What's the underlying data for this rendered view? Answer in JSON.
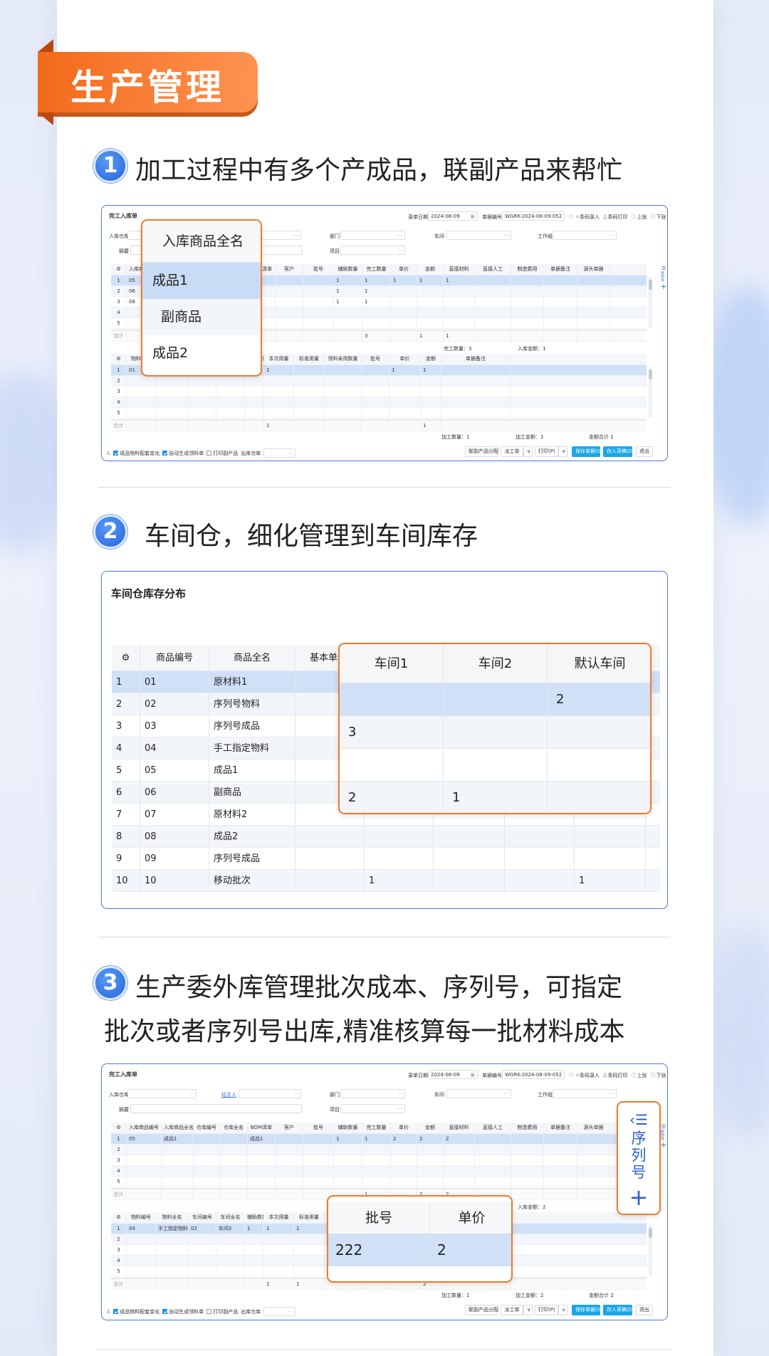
{
  "header": {
    "title": "生产管理"
  },
  "sections": [
    {
      "number": "1",
      "title": "加工过程中有多个产成品，联副产品来帮忙"
    },
    {
      "number": "2",
      "title": "车间仓，细化管理到车间库存"
    },
    {
      "number": "3",
      "title_lines": [
        "生产委外库管理批次成本、序列号，可指定",
        "批次或者序列号出库,精准核算每一批材料成本"
      ]
    }
  ],
  "colors": {
    "accent_orange": "#f07a2a",
    "brand_blue": "#2466dd",
    "selected_row": "#cfe0f7",
    "primary_button": "#1aa6ea"
  },
  "screen1": {
    "title": "完工入库单",
    "date_label": "录单日期",
    "date": "2024-08-09",
    "no_label": "单据编号",
    "no": "WGRK-2024-08-09-052",
    "toolbar": [
      "条码录入",
      "条码打印",
      "上张",
      "下张",
      "更多"
    ],
    "fields_row1": [
      {
        "label": "入库仓库"
      },
      {
        "label": ""
      },
      {
        "label": "部门"
      },
      {
        "label": "车间"
      },
      {
        "label": "工作组"
      }
    ],
    "fields_row2": [
      {
        "label": "摘要"
      },
      {
        "label": "项目"
      }
    ],
    "grid1": {
      "headers": [
        "入库商品编号",
        "入库商品全名",
        "仓库编号",
        "仓库全名",
        "BOM清单",
        "客户",
        "批号",
        "辅助数量",
        "完工数量",
        "单价",
        "金额",
        "直接材料",
        "直接人工",
        "制造费用",
        "单据备注",
        "源头单据"
      ],
      "rows": [
        [
          "05",
          "",
          "",
          "",
          "",
          "",
          "",
          "1",
          "1",
          "1",
          "1",
          "1",
          "",
          "",
          "",
          ""
        ],
        [
          "06",
          "",
          "",
          "",
          "",
          "",
          "",
          "1",
          "1",
          "",
          "",
          "",
          "",
          "",
          "",
          ""
        ],
        [
          "08",
          "",
          "",
          "",
          "",
          "",
          "",
          "1",
          "1",
          "",
          "",
          "",
          "",
          "",
          "",
          ""
        ]
      ],
      "total_label": "合计",
      "totals": [
        "",
        "",
        "",
        "",
        "",
        "",
        "",
        "",
        "3",
        "",
        "1",
        "1",
        "",
        "",
        "",
        ""
      ]
    },
    "summary1": [
      "完工数量：3",
      "入库金额：1"
    ],
    "grid2": {
      "headers": [
        "物料编号",
        "物料全名",
        "车间编号",
        "车间全名",
        "辅助数量",
        "本次用量",
        "标准用量",
        "领料未用数量",
        "批号",
        "单价",
        "金额",
        "单据备注"
      ],
      "rows": [
        [
          "01",
          "",
          "",
          "",
          "",
          "1",
          "",
          "",
          "",
          "1",
          "1",
          ""
        ]
      ],
      "total_label": "合计",
      "totals": [
        "",
        "",
        "",
        "",
        "",
        "1",
        "",
        "",
        "",
        "",
        "1",
        ""
      ]
    },
    "summary2": [
      "加工数量：1",
      "加工金额：1",
      "金额合计 1"
    ],
    "footer": {
      "checks": [
        {
          "label": "成品物料配套变化",
          "checked": true
        },
        {
          "label": "自动生成领料单",
          "checked": true
        },
        {
          "label": "打印副产品",
          "checked": false
        }
      ],
      "out_wh_label": "出库仓库",
      "buttons": [
        "联副产品分配",
        "派工单",
        "∨",
        "打印(P)",
        "∨",
        "保存单据(S)",
        "存入草稿(D)",
        "退出"
      ]
    },
    "side": {
      "label": "序列号",
      "add": "+"
    },
    "popup": {
      "header": "入库商品全名",
      "items": [
        "成品1",
        "副商品",
        "成品2"
      ],
      "selected": 0
    }
  },
  "screen2": {
    "title": "车间仓库存分布",
    "headers": [
      "商品编号",
      "商品全名",
      "基本单位",
      "",
      "",
      "",
      ""
    ],
    "rows": [
      [
        "1",
        "01",
        "原材料1",
        "",
        "",
        "",
        "",
        ""
      ],
      [
        "2",
        "02",
        "序列号物料",
        "",
        "",
        "",
        "",
        ""
      ],
      [
        "3",
        "03",
        "序列号成品",
        "",
        "",
        "",
        "",
        ""
      ],
      [
        "4",
        "04",
        "手工指定物料",
        "",
        "",
        "",
        "",
        ""
      ],
      [
        "5",
        "05",
        "成品1",
        "",
        "",
        "",
        "",
        ""
      ],
      [
        "6",
        "06",
        "副商品",
        "",
        "",
        "",
        "",
        ""
      ],
      [
        "7",
        "07",
        "原材料2",
        "",
        "",
        "",
        "",
        ""
      ],
      [
        "8",
        "08",
        "成品2",
        "",
        "",
        "",
        "",
        ""
      ],
      [
        "9",
        "09",
        "序列号成品",
        "",
        "",
        "",
        "",
        ""
      ],
      [
        "10",
        "10",
        "移动批次",
        "",
        "1",
        "",
        "",
        "1"
      ]
    ],
    "popup": {
      "headers": [
        "车间1",
        "车间2",
        "默认车间"
      ],
      "rows": [
        [
          "",
          "",
          "2"
        ],
        [
          "3",
          "",
          ""
        ],
        [
          "",
          "",
          ""
        ],
        [
          "2",
          "1",
          ""
        ]
      ]
    }
  },
  "screen3": {
    "title": "完工入库单",
    "date_label": "录单日期",
    "date": "2024-08-09",
    "no_label": "单据编号",
    "no": "WGRK-2024-08-09-052",
    "toolbar": [
      "条码录入",
      "条码打印",
      "上张",
      "下张",
      "更多"
    ],
    "fields_row1": [
      {
        "label": "入库仓库"
      },
      {
        "label": "经手人",
        "link": true
      },
      {
        "label": "部门"
      },
      {
        "label": "车间"
      },
      {
        "label": "工作组"
      }
    ],
    "fields_row2": [
      {
        "label": "摘要"
      },
      {
        "label": "项目"
      }
    ],
    "grid1": {
      "headers": [
        "入库商品编号",
        "入库商品全名",
        "仓库编号",
        "仓库全名",
        "BOM清单",
        "客户",
        "批号",
        "辅助数量",
        "完工数量",
        "单价",
        "金额",
        "直接材料",
        "直接人工",
        "制造费用",
        "单据备注",
        "源头单据"
      ],
      "rows": [
        [
          "05",
          "成品1",
          "",
          "",
          "成品1",
          "",
          "",
          "1",
          "1",
          "2",
          "2",
          "2",
          "",
          "",
          "",
          ""
        ]
      ],
      "total_label": "合计",
      "totals": [
        "",
        "",
        "",
        "",
        "",
        "",
        "",
        "",
        "1",
        "",
        "2",
        "2",
        "",
        "",
        "",
        ""
      ]
    },
    "summary1": [
      "",
      "入库金额：2"
    ],
    "grid2": {
      "headers": [
        "物料编号",
        "物料全名",
        "车间编号",
        "车间全名",
        "辅助数量",
        "本次用量",
        "标准用量",
        "领料未用数量",
        "批号",
        "单价",
        "金额",
        "单据备注"
      ],
      "rows": [
        [
          "04",
          "手工指定物料",
          "02",
          "车间2",
          "1",
          "1",
          "1",
          "",
          "",
          "",
          "",
          ""
        ]
      ],
      "total_label": "合计",
      "totals": [
        "",
        "",
        "",
        "",
        "",
        "1",
        "1",
        "",
        "",
        "",
        "2",
        ""
      ]
    },
    "summary2": [
      "加工数量：1",
      "加工金额：2",
      "金额合计 2"
    ],
    "footer": {
      "checks": [
        {
          "label": "成品物料配套变化",
          "checked": true
        },
        {
          "label": "自动生成领料单",
          "checked": true
        },
        {
          "label": "打印副产品",
          "checked": false
        }
      ],
      "out_wh_label": "出库仓库",
      "buttons": [
        "联副产品分配",
        "派工单",
        "∨",
        "打印(P)",
        "∨",
        "保存单据(S)",
        "存入草稿(D)",
        "退出"
      ]
    },
    "side": {
      "label": "序列号",
      "add": "+"
    },
    "serial_popup": {
      "label": "序列号",
      "add": "+"
    },
    "batch_popup": {
      "headers": [
        "批号",
        "单价"
      ],
      "rows": [
        [
          "222",
          "2"
        ]
      ]
    }
  }
}
